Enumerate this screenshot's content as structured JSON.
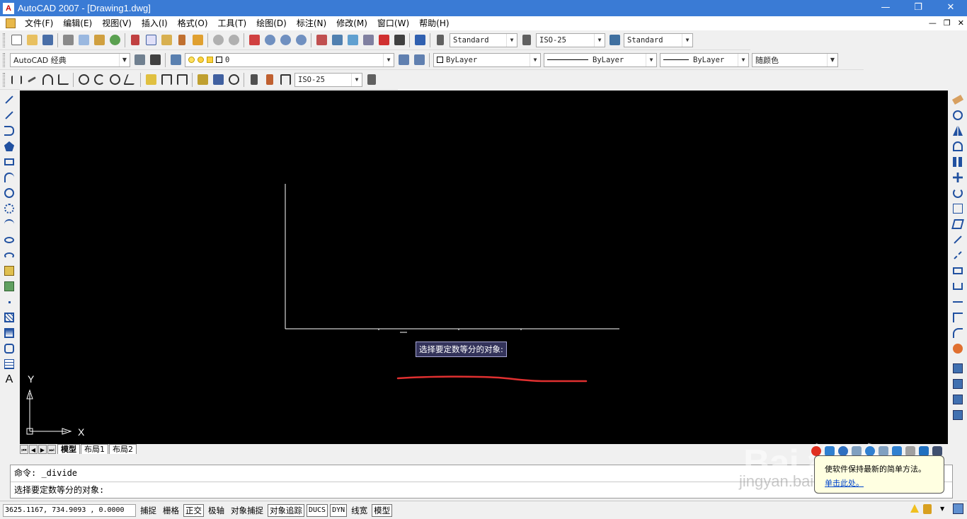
{
  "window": {
    "title": "AutoCAD 2007 - [Drawing1.dwg]",
    "app_icon_text": "A",
    "controls": [
      "—",
      "❐",
      "✕"
    ]
  },
  "menubar": {
    "items": [
      "文件(F)",
      "编辑(E)",
      "视图(V)",
      "插入(I)",
      "格式(O)",
      "工具(T)",
      "绘图(D)",
      "标注(N)",
      "修改(M)",
      "窗口(W)",
      "帮助(H)"
    ],
    "mdi_controls": [
      "—",
      "❐",
      "✕"
    ]
  },
  "toolbar_standard": {
    "text_style": "Standard",
    "dim_style": "ISO-25",
    "table_style": "Standard"
  },
  "toolbar_layers": {
    "workspace": "AutoCAD 经典",
    "current_layer": "0"
  },
  "toolbar_properties": {
    "color": "ByLayer",
    "linetype": "ByLayer",
    "lineweight": "ByLayer",
    "plot_style": "随颜色"
  },
  "toolbar_dimension": {
    "dim_style": "ISO-25"
  },
  "drawing": {
    "tooltip": "选择要定数等分的对象:",
    "ucs_x": "X",
    "ucs_y": "Y",
    "background": "#000000",
    "annotation_color": "#e03030"
  },
  "layout_tabs": {
    "nav": [
      "⏮",
      "◀",
      "▶",
      "⏭"
    ],
    "tabs": [
      "模型",
      "布局1",
      "布局2"
    ],
    "active": "模型"
  },
  "command": {
    "history": "命令: _divide",
    "prompt": "选择要定数等分的对象:"
  },
  "statusbar": {
    "coords": "3625.1167, 734.9093 , 0.0000",
    "toggles": [
      {
        "label": "捕捉",
        "on": false
      },
      {
        "label": "栅格",
        "on": false
      },
      {
        "label": "正交",
        "on": true
      },
      {
        "label": "极轴",
        "on": false
      },
      {
        "label": "对象捕捉",
        "on": false
      },
      {
        "label": "对象追踪",
        "on": true
      },
      {
        "label": "DUCS",
        "on": true
      },
      {
        "label": "DYN",
        "on": true
      },
      {
        "label": "线宽",
        "on": false
      },
      {
        "label": "模型",
        "on": true
      }
    ]
  },
  "balloon": {
    "text": "使软件保持最新的简单方法。",
    "link": "单击此处。"
  },
  "watermark": {
    "logo": "Bai 经验",
    "url": "jingyan.baidu.com"
  }
}
